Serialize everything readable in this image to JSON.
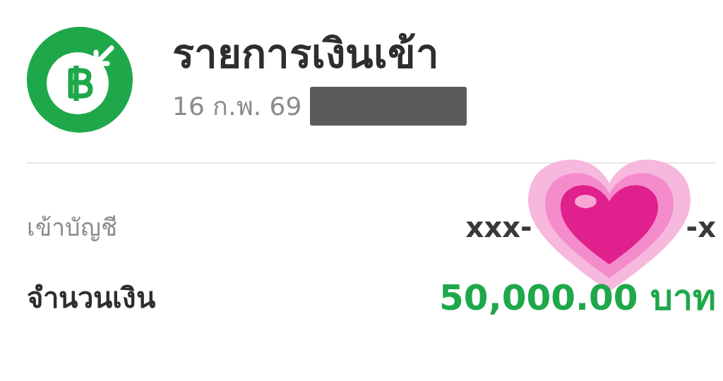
{
  "header": {
    "title": "รายการเงินเข้า",
    "date": "16 ก.พ. 69",
    "redacted": true
  },
  "rows": [
    {
      "kind": "account",
      "label": "เข้าบัญชี",
      "value_start": "xxx-",
      "value_end": "-x",
      "sticker": true
    },
    {
      "kind": "amount",
      "label": "จำนวนเงิน",
      "value": "50,000.00 บาท"
    }
  ]
}
